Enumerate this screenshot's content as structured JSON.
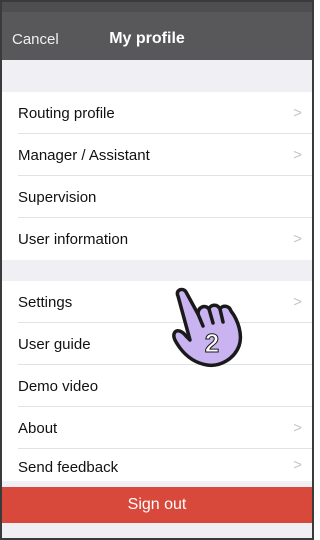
{
  "navbar": {
    "cancel_label": "Cancel",
    "title": "My profile"
  },
  "groups": [
    {
      "items": [
        {
          "label": "Routing profile",
          "chevron": true
        },
        {
          "label": "Manager / Assistant",
          "chevron": true
        },
        {
          "label": "Supervision",
          "chevron": false
        },
        {
          "label": "User information",
          "chevron": true
        }
      ]
    },
    {
      "items": [
        {
          "label": "Settings",
          "chevron": true
        },
        {
          "label": "User guide",
          "chevron": false
        },
        {
          "label": "Demo video",
          "chevron": false
        },
        {
          "label": "About",
          "chevron": true
        },
        {
          "label": "Send feedback",
          "chevron": true
        }
      ]
    }
  ],
  "signout_label": "Sign out",
  "overlay": {
    "icon": "pointing-hand-icon",
    "step_number": "2",
    "color": "#c9b3f0"
  },
  "colors": {
    "navbar": "#58585a",
    "signout": "#d8493c",
    "background": "#efeff4"
  }
}
